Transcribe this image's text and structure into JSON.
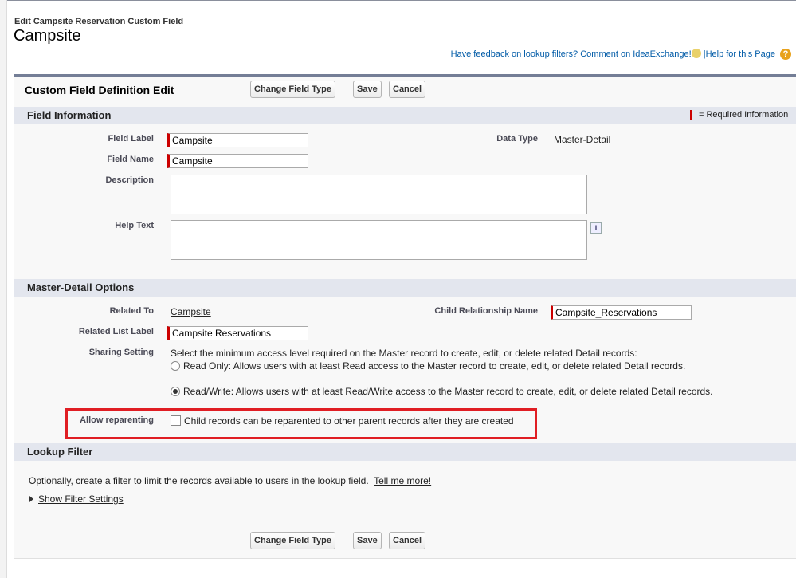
{
  "header": {
    "subtitle": "Edit Campsite Reservation Custom Field",
    "title": "Campsite",
    "feedback_link": "Have feedback on lookup filters? Comment on IdeaExchange!",
    "separator": "|",
    "help_link": "Help for this Page",
    "help_icon": "?"
  },
  "panel": {
    "title": "Custom Field Definition Edit",
    "change_type": "Change Field Type",
    "save": "Save",
    "cancel": "Cancel"
  },
  "field_info": {
    "title": "Field Information",
    "required_legend": "= Required Information",
    "field_label_lbl": "Field Label",
    "field_label": "Campsite",
    "field_name_lbl": "Field Name",
    "field_name": "Campsite",
    "description_lbl": "Description",
    "help_text_lbl": "Help Text",
    "info_icon": "i",
    "data_type_lbl": "Data Type",
    "data_type": "Master-Detail"
  },
  "master_detail": {
    "title": "Master-Detail Options",
    "related_to_lbl": "Related To",
    "related_to": "Campsite",
    "child_rel_lbl": "Child Relationship Name",
    "child_rel": "Campsite_Reservations",
    "related_list_lbl": "Related List Label",
    "related_list": "Campsite Reservations",
    "sharing_lbl": "Sharing Setting",
    "sharing_intro": "Select the minimum access level required on the Master record to create, edit, or delete related Detail records:",
    "opt_read": "Read Only: Allows users with at least Read access to the Master record to create, edit, or delete related Detail records.",
    "opt_rw": "Read/Write: Allows users with at least Read/Write access to the Master record to create, edit, or delete related Detail records.",
    "reparent_lbl": "Allow reparenting",
    "reparent_text": "Child records can be reparented to other parent records after they are created"
  },
  "lookup": {
    "title": "Lookup Filter",
    "text": "Optionally, create a filter to limit the records available to users in the lookup field.",
    "tell_more": "Tell me more!",
    "show_filter": "Show Filter Settings"
  }
}
